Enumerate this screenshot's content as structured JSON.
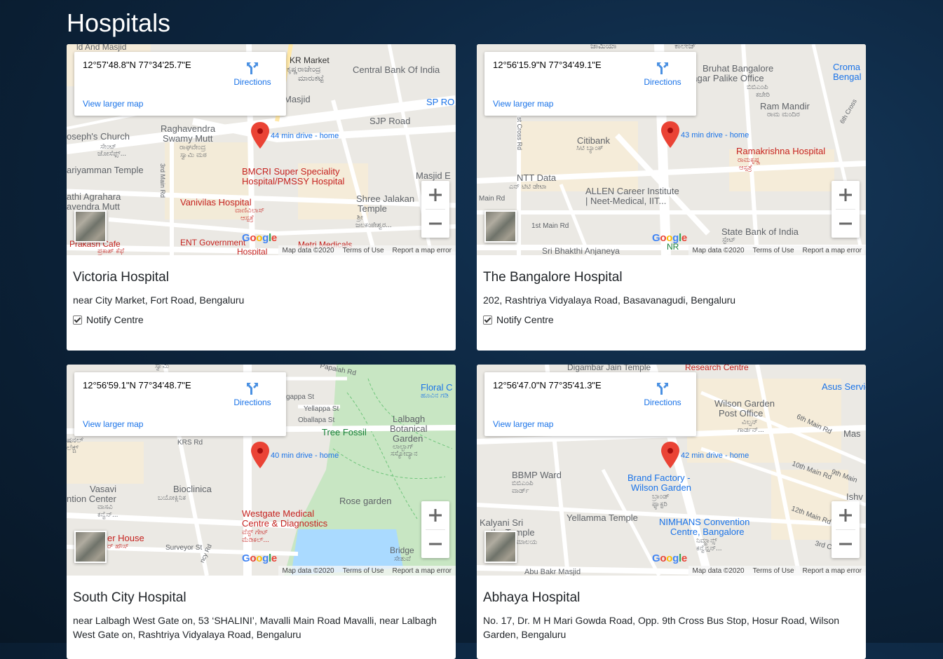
{
  "page": {
    "title": "Hospitals"
  },
  "map_common": {
    "directions_label": "Directions",
    "larger_map_label": "View larger map",
    "map_data": "Map data ©2020",
    "terms": "Terms of Use",
    "report": "Report a map error",
    "google_logo": "Google"
  },
  "hospitals": [
    {
      "name": "Victoria Hospital",
      "address": "near City Market, Fort Road, Bengaluru",
      "coords": "12°57'48.8\"N 77°34'25.7\"E",
      "notify_label": "Notify Centre",
      "notify_checked": true,
      "route_label": "44 min drive - home",
      "labels": [
        "ld And Masjid",
        "KR Market",
        "ಕೃಷ್ಣರಾಜೇಂದ್ರ",
        "ಮಾರುಕಟ್ಟೆ",
        "Central Bank Of India",
        "Masjid",
        "SP RO",
        "SJP Road",
        "oseph's Church",
        "ಸೇಂಟ್",
        "ಜೋಸೆಫ್ಸ್...",
        "Raghavendra",
        "Swamy Mutt",
        "ರಾಘವೇಂದ್ರ",
        "ಸ್ವಾಮಿ ಮಠ",
        "ariyamman Temple",
        "BMCRI Super Speciality",
        "Hospital/PMSSY Hospital",
        "Masjid E",
        "athi Agrahara",
        "avendra Mutt",
        "Vanivilas Hospital",
        "ವಾಣಿವಿಲಾಸ್",
        "ಆಸ್ಪತ್ರೆ",
        "Shree Jalakan",
        "Temple",
        "ಶ್ರೀ",
        "ಜಲಕಂಠೇಶ್ವರ...",
        "3rd Main Rd",
        "Prakash Cafe",
        "ಪ್ರಕಾಶ್ ಕೆಫೆ",
        "ENT Government",
        "Hospital",
        "Metri Medicals"
      ]
    },
    {
      "name": "The Bangalore Hospital",
      "address": "202, Rashtriya Vidyalaya Road, Basavanagudi, Bengaluru",
      "coords": "12°56'15.9\"N 77°34'49.1\"E",
      "notify_label": "Notify Centre",
      "notify_checked": true,
      "route_label": "43 min drive - home",
      "labels": [
        "ಜಾಮಿಯಾ",
        "ಕಾಲೇಜ್",
        "Bruhat Bangalore",
        "nagar Palike Office",
        "ಬಿಬಿಎಂಪಿ",
        "ಕಚೇರಿ",
        "Croma",
        "Bengal",
        "Ram Mandir",
        "ರಾಮ ಮಂದಿರ",
        "Citibank",
        "ಸಿಟಿ ಬ್ಯಾಂಕ್",
        "Ramakrishna Hospital",
        "ರಾಮಕೃಷ್ಣ",
        "ಆಸ್ಪತ್ರೆ",
        "NTT Data",
        "ಎನ್ ಟಿಟಿ ಡೇಟಾ",
        "ALLEN Career Institute",
        "| Neet-Medical, IIT...",
        "Main Rd",
        "1st Main Rd",
        "State Bank of India",
        "ಸ್ಟೇಟ್",
        "Sri Bhakthi Anjaneya",
        "NR",
        "6th Cross",
        "st Cross Rd"
      ]
    },
    {
      "name": "South City Hospital",
      "address": "near Lalbagh West Gate on, 53 ‘SHALINI’, Mavalli Main Road Mavalli, near Lalbagh West Gate on, Rashtriya Vidyalaya Road, Bengaluru",
      "coords": "12°56'59.1\"N 77°34'48.7\"E",
      "notify_label": "Notify Centre",
      "notify_checked": true,
      "route_label": "40 min drive - home",
      "labels": [
        "ಸ್ವಾಮಿ",
        "Papaiah Rd",
        "Floral C",
        "ಹೂವಿನ ಗಡಿ",
        "gappa St",
        "Yellappa St",
        "Oballapa St",
        "Lalbagh",
        "Botanical",
        "Garden",
        "ಲಾಲ್ಬಾಗ್",
        "ಸಸ್ಯೋದ್ಯಾನ",
        "Tree Fossil",
        "ಷನಲ್",
        "ಲೆಕ್ಚ್",
        "KRS Rd",
        "Vasavi",
        "ntion Center",
        "ವಾಸವಿ",
        "ಕನ್ವೆನ್...",
        "Bioclinica",
        "ಬಯೋಕ್ಲಿನಿಕ",
        "Rose garden",
        "Westgate Medical",
        "Centre & Diagnostics",
        "ವೆಸ್ಟ್ ಗೇಟ್",
        "ಮೆಡಿಕಲ್...",
        "er House",
        "ರ್ ಹೌಸ್",
        "Surveyor St",
        "Bridge",
        "ಸೇತುವೆ",
        "ncy Rd"
      ]
    },
    {
      "name": "Abhaya Hospital",
      "address": "No. 17, Dr. M H Mari Gowda Road, Opp. 9th Cross Bus Stop, Hosur Road, Wilson Garden, Bengaluru",
      "coords": "12°56'47.0\"N 77°35'41.3\"E",
      "notify_label": "Notify Centre",
      "notify_checked": true,
      "route_label": "42 min drive - home",
      "labels": [
        "Digambar Jain Temple",
        "Research Centre",
        "Asus Servic",
        "Wilson Garden",
        "Post Office",
        "ವಿಲ್ಸನ್",
        "ಗಾರ್ಡನ್...",
        "6th Main Rd",
        "Mas",
        "BBMP Ward",
        "ಬಿಬಿಎಂಪಿ",
        "ವಾರ್ಡ್",
        "Brand Factory -",
        "Wilson Garden",
        "ಬ್ರಾಂಡ್",
        "ಫ್ಯಾಕ್ಟರಿ",
        "10th Main Rd",
        "9th Main",
        "Ishv",
        "Yellamma Temple",
        "Kalyani Sri",
        "thy Temple",
        "ಮಾಲಯ",
        "NIMHANS Convention",
        "Centre, Bangalore",
        "ನಿಮ್ಹಾನ್ಸ್",
        "ಕನ್ವೆನ್ಷನ್...",
        "12th Main Rd",
        "3rd Cro",
        "Abu Bakr Masjid"
      ]
    }
  ],
  "colors": {
    "pin": "#ea4335",
    "link": "#1a73e8",
    "hospital_label": "#c5221f",
    "park": "#c8e6c3",
    "water": "#aadaff"
  },
  "icons": [
    "directions-icon",
    "map-pin-icon",
    "zoom-in-icon",
    "zoom-out-icon",
    "hospital-icon",
    "checkbox-checked-icon"
  ]
}
